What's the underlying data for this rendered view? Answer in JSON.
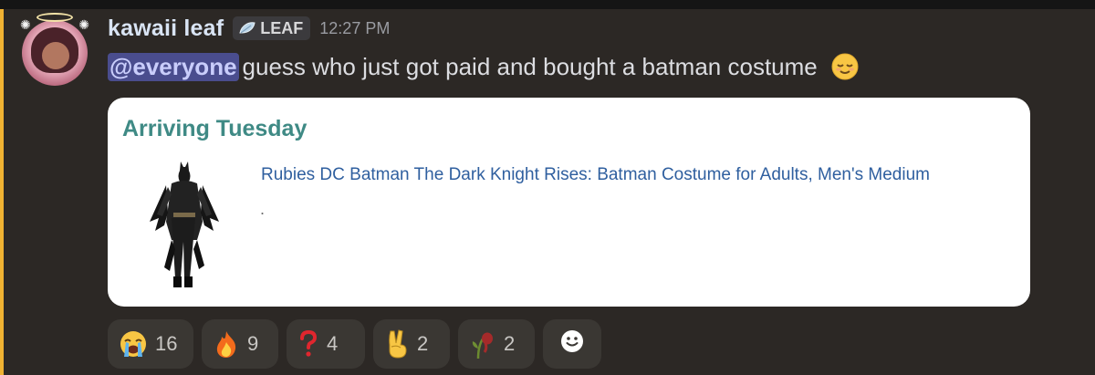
{
  "message": {
    "username": "kawaii leaf",
    "role_tag": "LEAF",
    "timestamp": "12:27 PM",
    "mention": "@everyone",
    "text": "guess who just got paid and bought a batman costume",
    "inline_emoji": "relieved-face"
  },
  "embed": {
    "title": "Arriving Tuesday",
    "product_link": "Rubies DC Batman The Dark Knight Rises: Batman Costume for Adults, Men's Medium",
    "dot": "."
  },
  "reactions": [
    {
      "emoji": "loudly-crying-face",
      "count": "16"
    },
    {
      "emoji": "fire",
      "count": "9"
    },
    {
      "emoji": "red-question-mark",
      "count": "4"
    },
    {
      "emoji": "victory-hand",
      "count": "2"
    },
    {
      "emoji": "wilted-flower",
      "count": "2"
    }
  ],
  "colors": {
    "background": "#2c2825",
    "mention_bar": "#f0b232",
    "username": "#d9e4f4",
    "embed_title": "#3f8a85",
    "product_link": "#2f5f9f"
  }
}
